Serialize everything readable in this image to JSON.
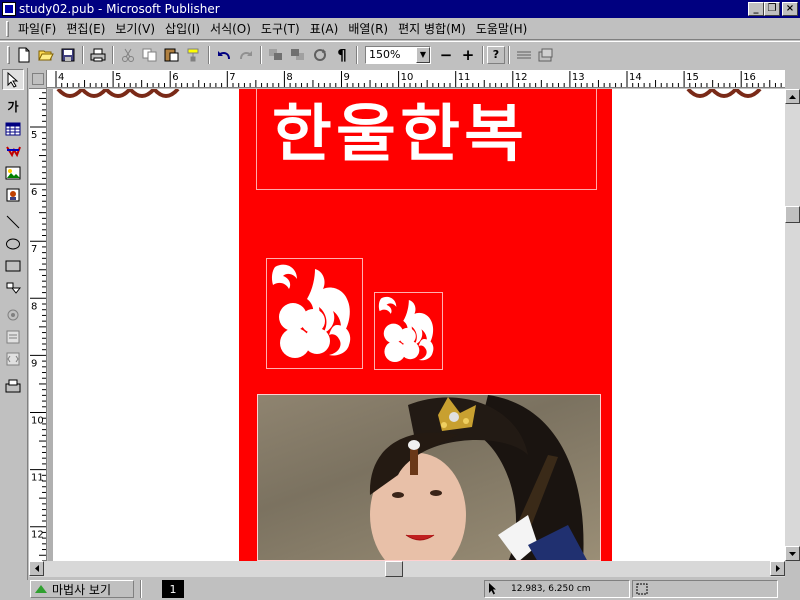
{
  "window": {
    "title": "study02.pub - Microsoft Publisher",
    "buttons": {
      "minimize": "_",
      "restore": "❐",
      "close": "×"
    }
  },
  "menu": [
    "파일(F)",
    "편집(E)",
    "보기(V)",
    "삽입(I)",
    "서식(O)",
    "도구(T)",
    "표(A)",
    "배열(R)",
    "편지 병합(M)",
    "도움말(H)"
  ],
  "toolbar": {
    "zoom_value": "150%",
    "zoom_minus": "−",
    "zoom_plus": "+",
    "paragraph_mark": "¶",
    "help_mark": "?"
  },
  "tools": {
    "text_tool_label": "가"
  },
  "rulers": {
    "horizontal": [
      "4",
      "5",
      "6",
      "7",
      "8",
      "9",
      "10",
      "11",
      "12",
      "13",
      "14",
      "15",
      "16"
    ],
    "vertical": [
      "5",
      "6",
      "7",
      "8",
      "9",
      "10",
      "11",
      "12"
    ]
  },
  "document": {
    "headline": "한울한복",
    "colors": {
      "panel": "#ff0000",
      "text": "#ffffff"
    }
  },
  "status": {
    "wizard_label": "마법사 보기",
    "page_number": "1",
    "coordinates": "12.983, 6.250 cm",
    "object_size": ""
  }
}
